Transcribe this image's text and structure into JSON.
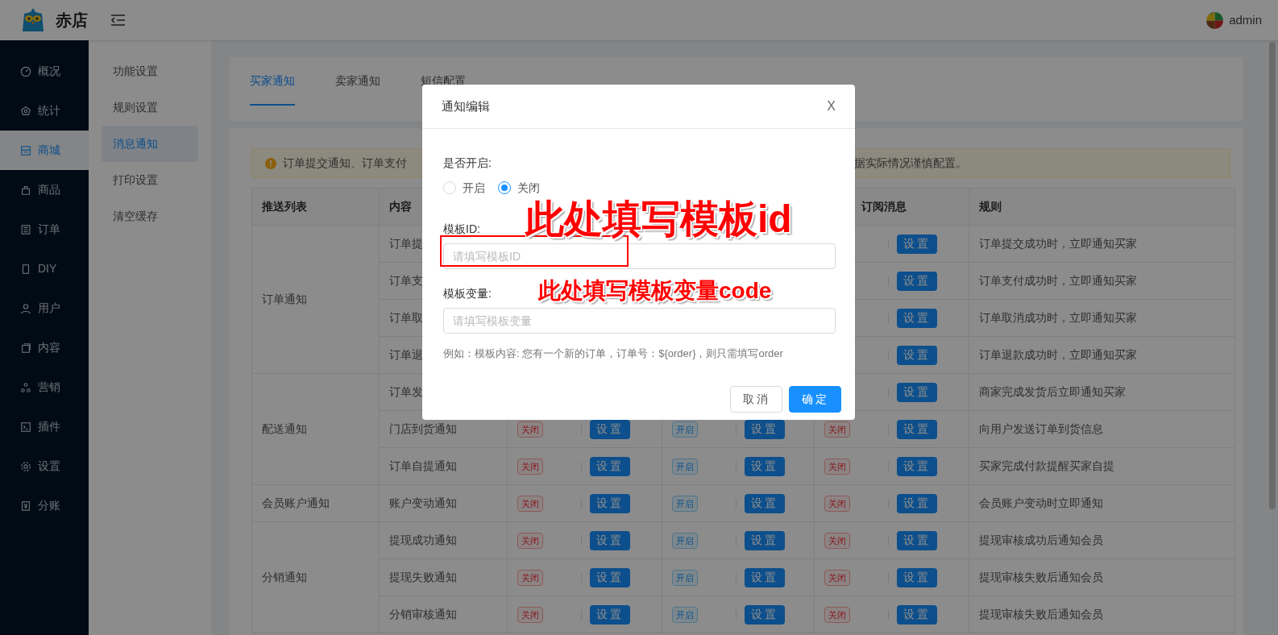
{
  "header": {
    "brand": "赤店",
    "user": "admin"
  },
  "sidebar": {
    "items": [
      {
        "label": "概况",
        "selected": false
      },
      {
        "label": "统计",
        "selected": false
      },
      {
        "label": "商城",
        "selected": true
      },
      {
        "label": "商品",
        "selected": false
      },
      {
        "label": "订单",
        "selected": false
      },
      {
        "label": "DIY",
        "selected": false
      },
      {
        "label": "用户",
        "selected": false
      },
      {
        "label": "内容",
        "selected": false
      },
      {
        "label": "营销",
        "selected": false
      },
      {
        "label": "插件",
        "selected": false
      },
      {
        "label": "设置",
        "selected": false
      },
      {
        "label": "分账",
        "selected": false
      }
    ]
  },
  "submenu": {
    "items": [
      {
        "label": "功能设置",
        "selected": false
      },
      {
        "label": "规则设置",
        "selected": false
      },
      {
        "label": "消息通知",
        "selected": true
      },
      {
        "label": "打印设置",
        "selected": false
      },
      {
        "label": "清空缓存",
        "selected": false
      }
    ]
  },
  "tabs": [
    {
      "label": "买家通知",
      "selected": true
    },
    {
      "label": "卖家通知",
      "selected": false
    },
    {
      "label": "短信配置",
      "selected": false
    }
  ],
  "alert": {
    "text_left": "订单提交通知、订单支付",
    "text_right": "据实际情况谨慎配置。"
  },
  "table": {
    "columns": {
      "column_1": "推送列表",
      "column_2": "内容",
      "column_5": "订阅消息",
      "column_6": "规则"
    },
    "groups": [
      {
        "name": "订单通知",
        "rows": [
          {
            "content": "订单提",
            "cells": {
              "column_5": {
                "button": "设置"
              }
            },
            "rule": "订单提交成功时，立即通知买家"
          },
          {
            "content": "订单支",
            "cells": {
              "column_5": {
                "button": "设置"
              }
            },
            "rule": "订单支付成功时，立即通知买家"
          },
          {
            "content": "订单取",
            "cells": {
              "column_5": {
                "button": "设置"
              }
            },
            "rule": "订单取消成功时，立即通知买家"
          },
          {
            "content": "订单退",
            "cells": {
              "column_5": {
                "button": "设置"
              }
            },
            "rule": "订单退款成功时，立即通知买家"
          }
        ]
      },
      {
        "name": "配送通知",
        "rows": [
          {
            "content": "订单发",
            "cells": {
              "column_5": {
                "button": "设置"
              }
            },
            "rule": "商家完成发货后立即通知买家"
          },
          {
            "content": "门店到货通知",
            "cells": {
              "column_3": {
                "tag": "关闭",
                "on": false,
                "button": "设置"
              },
              "column_4": {
                "tag": "开启",
                "on": true,
                "button": "设置"
              },
              "column_5": {
                "tag": "关闭",
                "on": false,
                "button": "设置"
              }
            },
            "rule": "向用户发送订单到货信息"
          },
          {
            "content": "订单自提通知",
            "cells": {
              "column_3": {
                "tag": "关闭",
                "on": false,
                "button": "设置"
              },
              "column_4": {
                "tag": "开启",
                "on": true,
                "button": "设置"
              },
              "column_5": {
                "tag": "关闭",
                "on": false,
                "button": "设置"
              }
            },
            "rule": "买家完成付款提醒买家自提"
          }
        ]
      },
      {
        "name": "会员账户通知",
        "rows": [
          {
            "content": "账户变动通知",
            "cells": {
              "column_3": {
                "tag": "关闭",
                "on": false,
                "button": "设置"
              },
              "column_4": {
                "tag": "开启",
                "on": true,
                "button": "设置"
              },
              "column_5": {
                "tag": "关闭",
                "on": false,
                "button": "设置"
              }
            },
            "rule": "会员账户变动时立即通知"
          }
        ]
      },
      {
        "name": "分销通知",
        "rows": [
          {
            "content": "提现成功通知",
            "cells": {
              "column_3": {
                "tag": "关闭",
                "on": false,
                "button": "设置"
              },
              "column_4": {
                "tag": "开启",
                "on": true,
                "button": "设置"
              },
              "column_5": {
                "tag": "关闭",
                "on": false,
                "button": "设置"
              }
            },
            "rule": "提现审核成功后通知会员"
          },
          {
            "content": "提现失败通知",
            "cells": {
              "column_3": {
                "tag": "关闭",
                "on": false,
                "button": "设置"
              },
              "column_4": {
                "tag": "开启",
                "on": true,
                "button": "设置"
              },
              "column_5": {
                "tag": "关闭",
                "on": false,
                "button": "设置"
              }
            },
            "rule": "提现审核失败后通知会员"
          },
          {
            "content": "分销审核通知",
            "cells": {
              "column_3": {
                "tag": "关闭",
                "on": false,
                "button": "设置"
              },
              "column_4": {
                "tag": "开启",
                "on": true,
                "button": "设置"
              },
              "column_5": {
                "tag": "关闭",
                "on": false,
                "button": "设置"
              }
            },
            "rule": "提现审核失败后通知会员"
          }
        ]
      }
    ]
  },
  "dialog": {
    "title": "通知编辑",
    "close": "X",
    "enable_label": "是否开启:",
    "radios": [
      {
        "label": "开启",
        "selected": false
      },
      {
        "label": "关闭",
        "selected": true
      }
    ],
    "template_id_label": "模板ID:",
    "template_id_placeholder": "请填写模板ID",
    "variables_label": "模板变量:",
    "variables_placeholder": "请填写模板变量",
    "hint": "例如：模板内容: 您有一个新的订单，订单号：${order}，则只需填写order",
    "buttons": [
      {
        "label": "取消",
        "kind": "secondary"
      },
      {
        "label": "确定",
        "kind": "primary"
      }
    ]
  },
  "annotations": [
    {
      "text": "此处填写模板id",
      "kind": "large"
    },
    {
      "text": "此处填写模板变量code",
      "kind": "small"
    }
  ]
}
